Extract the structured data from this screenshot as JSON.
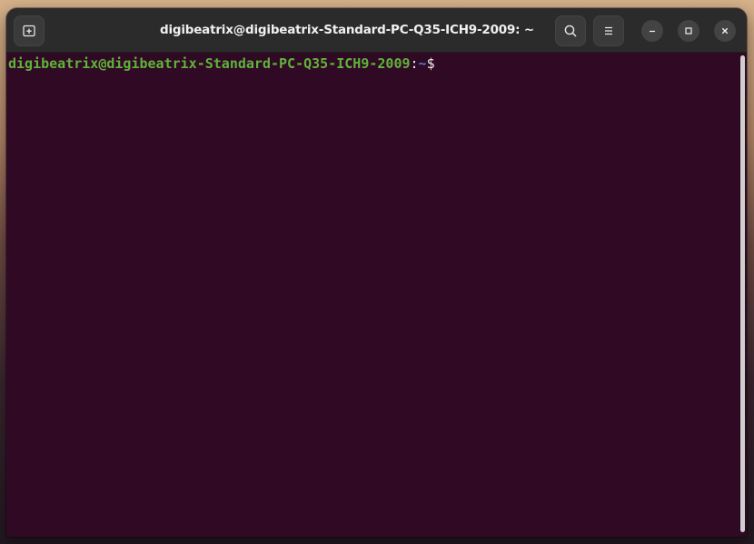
{
  "window": {
    "title": "digibeatrix@digibeatrix-Standard-PC-Q35-ICH9-2009: ~"
  },
  "toolbar": {
    "new_tab_icon": "new-tab-icon",
    "search_icon": "search-icon",
    "menu_icon": "hamburger-menu-icon"
  },
  "window_controls": {
    "minimize_icon": "minimize-icon",
    "maximize_icon": "maximize-icon",
    "close_icon": "close-icon"
  },
  "terminal": {
    "prompt_user_host": "digibeatrix@digibeatrix-Standard-PC-Q35-ICH9-2009",
    "prompt_colon": ":",
    "prompt_path": "~",
    "prompt_symbol": "$"
  },
  "colors": {
    "terminal_bg": "#300a24",
    "prompt_user_color": "#5fb33a",
    "prompt_path_color": "#4f7ed1",
    "headerbar_bg": "#2b2b2b"
  }
}
